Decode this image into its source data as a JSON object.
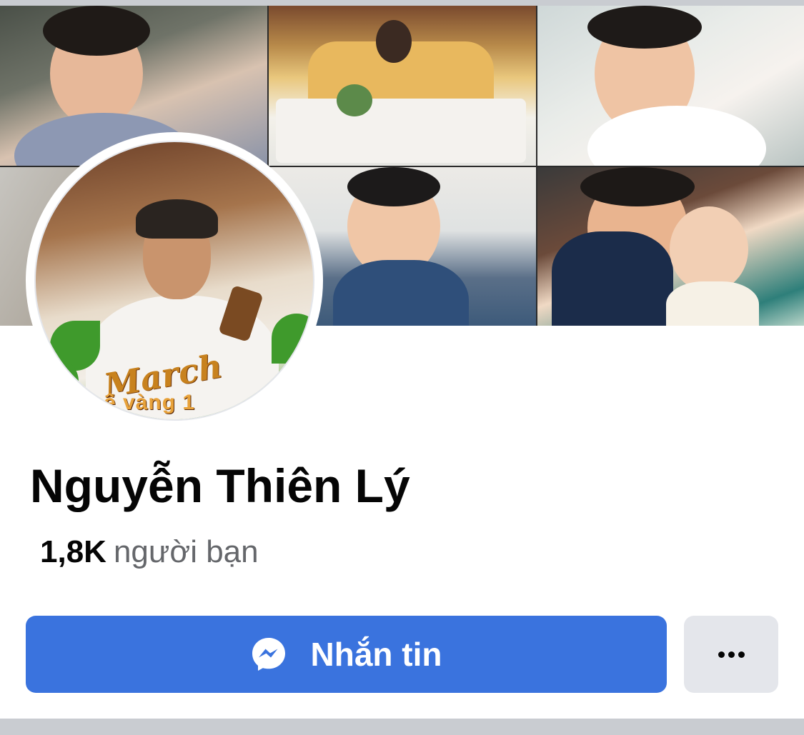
{
  "profile": {
    "name": "Nguyễn Thiên Lý",
    "friends_count": "1,8K",
    "friends_label": "người bạn",
    "avatar_overlay_text": "March",
    "avatar_overlay_subtext": "ệ vàng 1"
  },
  "actions": {
    "message_label": "Nhắn tin",
    "message_icon": "messenger-icon",
    "more_icon": "more-dots-icon"
  },
  "colors": {
    "primary_button": "#3a73de",
    "secondary_button": "#e4e6eb",
    "name_text": "#050505",
    "secondary_text": "#65676b"
  }
}
